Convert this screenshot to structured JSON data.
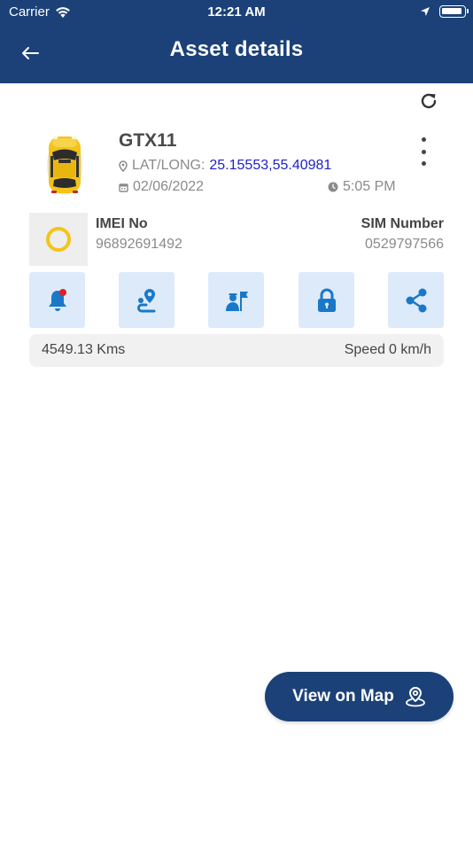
{
  "status_bar": {
    "carrier": "Carrier",
    "time": "12:21 AM"
  },
  "header": {
    "title": "Asset details"
  },
  "asset": {
    "name": "GTX11",
    "latlong_label": "LAT/LONG:",
    "latlong_value": "25.15553,55.40981",
    "date": "02/06/2022",
    "time": "5:05 PM",
    "imei_label": "IMEI No",
    "imei_value": "96892691492",
    "sim_label": "SIM Number",
    "sim_value": "0529797566",
    "status_color": "#f4c419"
  },
  "actions": [
    {
      "icon": "alert-bell-icon",
      "has_notification": true
    },
    {
      "icon": "route-icon"
    },
    {
      "icon": "driver-flag-icon"
    },
    {
      "icon": "lock-icon"
    },
    {
      "icon": "share-icon"
    }
  ],
  "stats": {
    "distance": "4549.13 Kms",
    "speed_label": "Speed",
    "speed_value": "0 km/h"
  },
  "map_button": {
    "label": "View on Map",
    "icon": "map-pin-icon"
  },
  "colors": {
    "primary": "#1b4178",
    "icon_blue": "#1a78c8",
    "icon_bg": "#dceafa",
    "link_blue": "#1e22c8",
    "notification_dot": "#e02020"
  }
}
